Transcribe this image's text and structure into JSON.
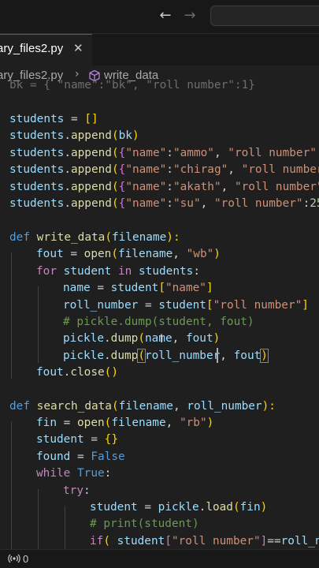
{
  "titlebar": {
    "back_icon": "arrow-left-icon",
    "forward_icon": "arrow-right-icon"
  },
  "tab": {
    "label": "ary_files2.py",
    "close_icon": "close-icon"
  },
  "breadcrumb": {
    "file": "ary_files2.py",
    "symbol": "write_data",
    "symbol_icon": "method-cube-icon"
  },
  "status": {
    "ports_icon": "broadcast-icon",
    "count": "0"
  },
  "code": {
    "l0": "bk = { \"name\":\"bk\", \"roll number\":1}",
    "l2a": "students",
    "l2b": " = ",
    "l2c": "[]",
    "l3a": "students",
    "l3b": ".",
    "l3c": "append",
    "l3d": "(",
    "l3e": "bk",
    "l3f": ")",
    "l4a": "students",
    "l4b": ".",
    "l4c": "append",
    "l4d": "(",
    "l4e": "{",
    "l4f": "\"name\"",
    "l4g": ":",
    "l4h": "\"ammo\"",
    "l4i": ", ",
    "l4j": "\"roll number\"",
    "l4k": ":",
    "l5a": "students",
    "l5b": ".",
    "l5c": "append",
    "l5d": "(",
    "l5e": "{",
    "l5f": "\"name\"",
    "l5g": ":",
    "l5h": "\"chirag\"",
    "l5i": ", ",
    "l5j": "\"roll number",
    "l6a": "students",
    "l6b": ".",
    "l6c": "append",
    "l6d": "(",
    "l6e": "{",
    "l6f": "\"name\"",
    "l6g": ":",
    "l6h": "\"akath\"",
    "l6i": ", ",
    "l6j": "\"roll number\"",
    "l7a": "students",
    "l7b": ".",
    "l7c": "append",
    "l7d": "(",
    "l7e": "{",
    "l7f": "\"name\"",
    "l7g": ":",
    "l7h": "\"su\"",
    "l7i": ", ",
    "l7j": "\"roll number\"",
    "l7k": ":",
    "l7l": "25",
    "l9a": "def",
    "l9b": " ",
    "l9c": "write_data",
    "l9d": "(",
    "l9e": "filename",
    "l9f": "):",
    "l10a": "fout",
    "l10b": " = ",
    "l10c": "open",
    "l10d": "(",
    "l10e": "filename",
    "l10f": ", ",
    "l10g": "\"wb\"",
    "l10h": ")",
    "l11a": "for",
    "l11b": " ",
    "l11c": "student",
    "l11d": " ",
    "l11e": "in",
    "l11f": " ",
    "l11g": "students",
    "l11h": ":",
    "l12a": "name",
    "l12b": " = ",
    "l12c": "student",
    "l12d": "[",
    "l12e": "\"name\"",
    "l12f": "]",
    "l13a": "roll_number",
    "l13b": " = ",
    "l13c": "student",
    "l13d": "[",
    "l13e": "\"roll number\"",
    "l13f": "]",
    "l14": "# pickle.dump(student, fout)",
    "l15a": "pickle",
    "l15b": ".",
    "l15c": "dump",
    "l15d": "(",
    "l15e": "name",
    "l15f": ", ",
    "l15g": "fout",
    "l15h": ")",
    "l16a": "pickle",
    "l16b": ".",
    "l16c": "dump",
    "l16d": "(",
    "l16e": "roll_number",
    "l16f": ", ",
    "l16g": "fout",
    "l16h": ")",
    "l17a": "fout",
    "l17b": ".",
    "l17c": "close",
    "l17d": "()",
    "l19a": "def",
    "l19b": " ",
    "l19c": "search_data",
    "l19d": "(",
    "l19e": "filename",
    "l19f": ", ",
    "l19g": "roll_number",
    "l19h": "):",
    "l20a": "fin",
    "l20b": " = ",
    "l20c": "open",
    "l20d": "(",
    "l20e": "filename",
    "l20f": ", ",
    "l20g": "\"rb\"",
    "l20h": ")",
    "l21a": "student",
    "l21b": " = ",
    "l21c": "{}",
    "l22a": "found",
    "l22b": " = ",
    "l22c": "False",
    "l23a": "while",
    "l23b": " ",
    "l23c": "True",
    "l23d": ":",
    "l24a": "try",
    "l24b": ":",
    "l25a": "student",
    "l25b": " = ",
    "l25c": "pickle",
    "l25d": ".",
    "l25e": "load",
    "l25f": "(",
    "l25g": "fin",
    "l25h": ")",
    "l26": "# print(student)",
    "l27a": "if",
    "l27b": "( ",
    "l27c": "student",
    "l27d": "[",
    "l27e": "\"roll number\"",
    "l27f": "]",
    "l27g": "==",
    "l27h": "roll_n"
  }
}
